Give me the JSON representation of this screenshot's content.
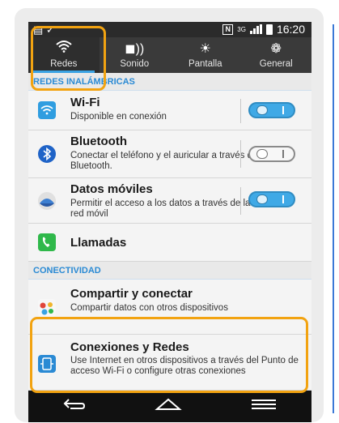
{
  "status_bar": {
    "network": "3G",
    "time": "16:20"
  },
  "tabs": [
    {
      "label": "Redes",
      "icon": "wifi-icon",
      "active": true
    },
    {
      "label": "Sonido",
      "icon": "speaker-icon",
      "active": false
    },
    {
      "label": "Pantalla",
      "icon": "brightness-icon",
      "active": false
    },
    {
      "label": "General",
      "icon": "gear-icon",
      "active": false
    }
  ],
  "sections": {
    "wireless": "REDES INALÁMBRICAS",
    "connectivity": "CONECTIVIDAD"
  },
  "rows": [
    {
      "title": "Wi-Fi",
      "subtitle": "Disponible en conexión",
      "toggle": "on",
      "icon": "wifi-icon"
    },
    {
      "title": "Bluetooth",
      "subtitle": "Conectar el teléfono y el auricular a través del Bluetooth.",
      "toggle": "off",
      "icon": "bluetooth-icon"
    },
    {
      "title": "Datos móviles",
      "subtitle": "Permitir el acceso a los datos a través de la red móvil",
      "toggle": "on",
      "icon": "mobile-data-icon"
    },
    {
      "title": "Llamadas",
      "subtitle": "",
      "icon": "phone-icon"
    },
    {
      "title": "Compartir y conectar",
      "subtitle": "Compartir datos con otros dispositivos",
      "icon": "share-connect-icon"
    },
    {
      "title": "Conexiones y Redes",
      "subtitle": "Use Internet en otros dispositivos a través del Punto de acceso Wi-Fi o configure otras conexiones",
      "icon": "tethering-icon"
    }
  ],
  "navbar": {
    "back_icon": "back-icon",
    "home_icon": "home-icon",
    "menu_icon": "menu-icon"
  },
  "colors": {
    "accent": "#3aa3e3",
    "highlight": "#f2a311",
    "section_text": "#2a8ad4"
  }
}
